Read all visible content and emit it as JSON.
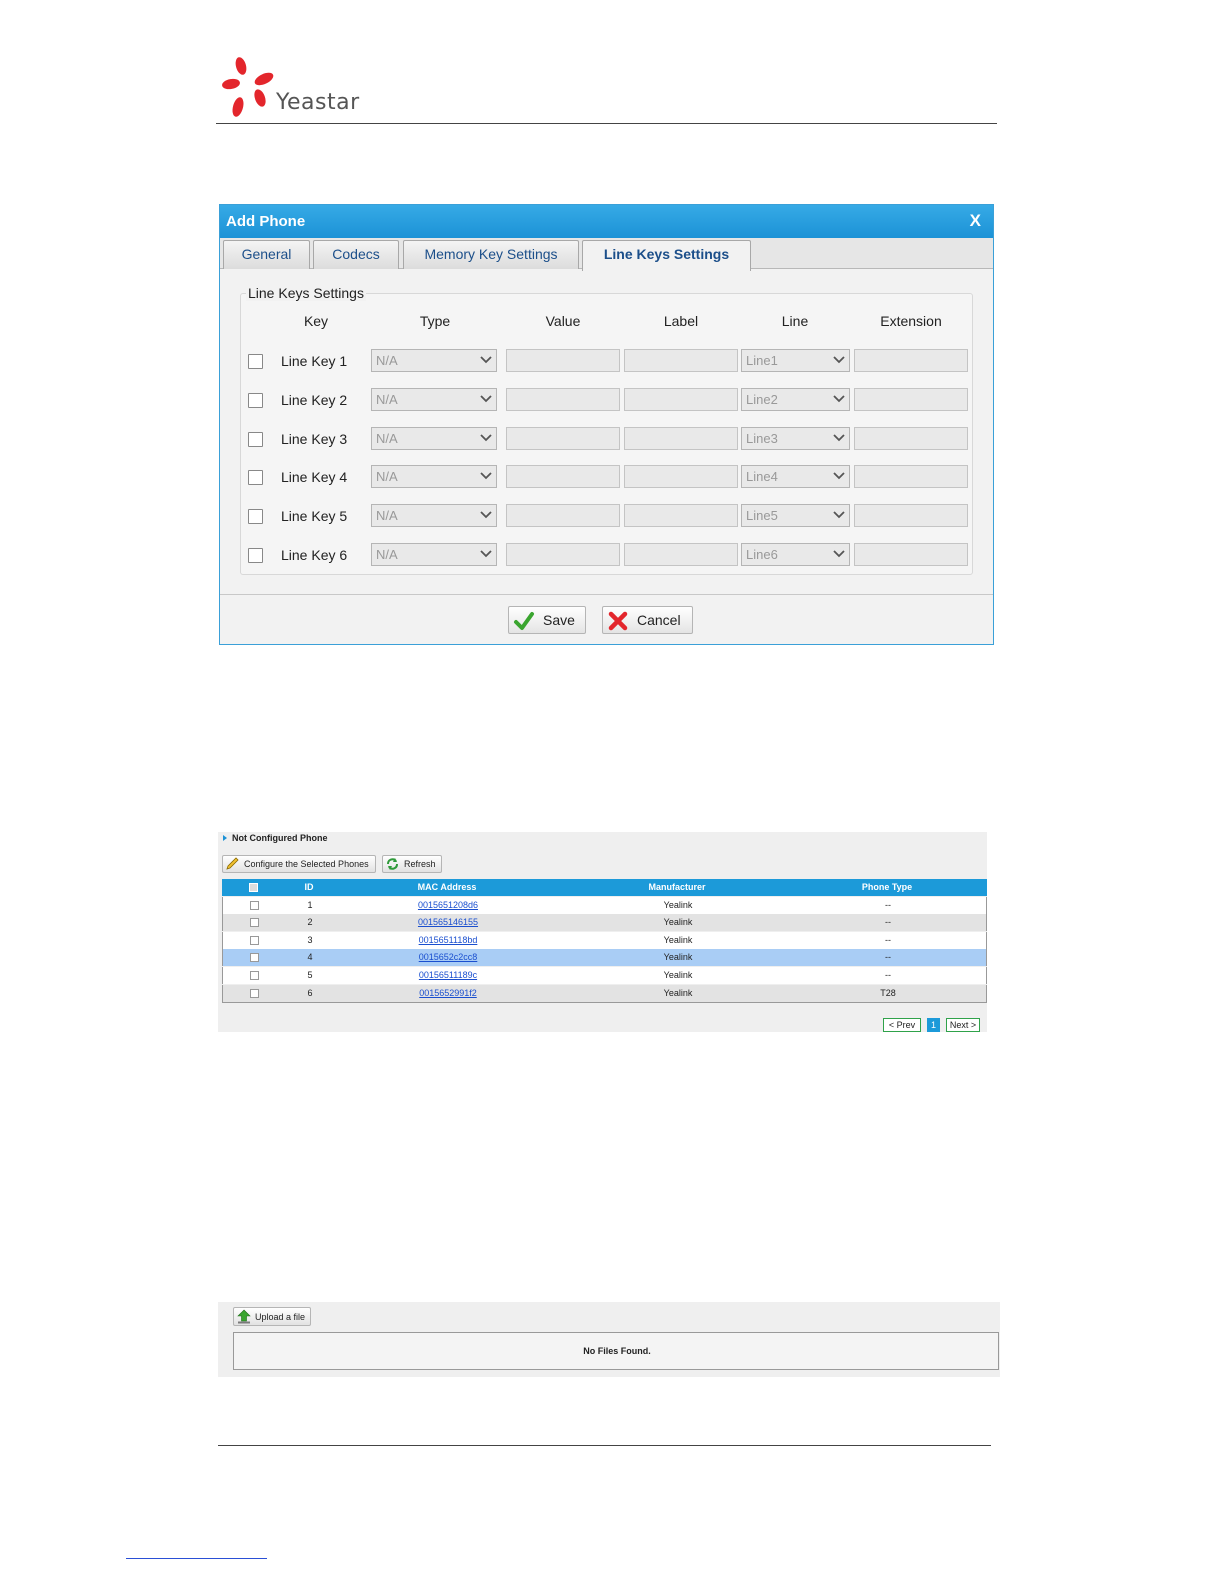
{
  "brand": {
    "name": "Yeastar",
    "accent": "#e3262c"
  },
  "dialog": {
    "title": "Add Phone",
    "close_label": "X",
    "tabs": [
      {
        "label": "General",
        "active": false
      },
      {
        "label": "Codecs",
        "active": false
      },
      {
        "label": "Memory Key Settings",
        "active": false
      },
      {
        "label": "Line Keys Settings",
        "active": true
      }
    ],
    "section_title": "Line Keys Settings",
    "columns": [
      "Key",
      "Type",
      "Value",
      "Label",
      "Line",
      "Extension"
    ],
    "rows": [
      {
        "key": "Line Key 1",
        "type": "N/A",
        "line": "Line1"
      },
      {
        "key": "Line Key 2",
        "type": "N/A",
        "line": "Line2"
      },
      {
        "key": "Line Key 3",
        "type": "N/A",
        "line": "Line3"
      },
      {
        "key": "Line Key 4",
        "type": "N/A",
        "line": "Line4"
      },
      {
        "key": "Line Key 5",
        "type": "N/A",
        "line": "Line5"
      },
      {
        "key": "Line Key 6",
        "type": "N/A",
        "line": "Line6"
      }
    ],
    "save_label": "Save",
    "cancel_label": "Cancel"
  },
  "phones": {
    "title": "Not Configured Phone",
    "configure_label": "Configure the Selected Phones",
    "refresh_label": "Refresh",
    "columns": [
      "ID",
      "MAC Address",
      "Manufacturer",
      "Phone Type"
    ],
    "rows": [
      {
        "id": "1",
        "mac": "0015651208d6",
        "manufacturer": "Yealink",
        "type": "--"
      },
      {
        "id": "2",
        "mac": "001565146155",
        "manufacturer": "Yealink",
        "type": "--"
      },
      {
        "id": "3",
        "mac": "0015651118bd",
        "manufacturer": "Yealink",
        "type": "--"
      },
      {
        "id": "4",
        "mac": "0015652c2cc8",
        "manufacturer": "Yealink",
        "type": "--",
        "selected": true
      },
      {
        "id": "5",
        "mac": "00156511189c",
        "manufacturer": "Yealink",
        "type": "--"
      },
      {
        "id": "6",
        "mac": "0015652991f2",
        "manufacturer": "Yealink",
        "type": "T28"
      }
    ],
    "pager": {
      "prev": "< Prev",
      "page": "1",
      "next": "Next >"
    }
  },
  "files": {
    "upload_label": "Upload a file",
    "empty_text": "No Files Found."
  }
}
